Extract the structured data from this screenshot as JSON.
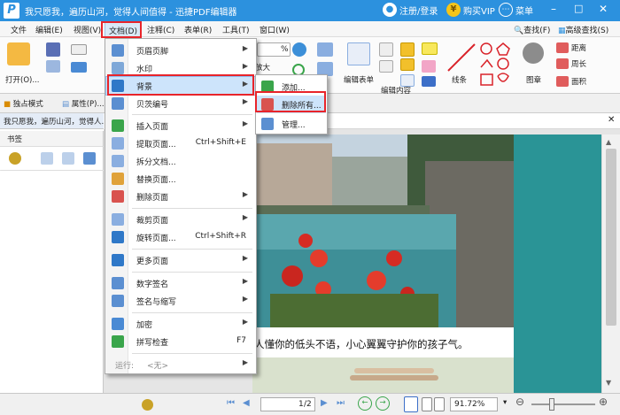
{
  "app": {
    "title": "我只愿我，遍历山河，觉得人间值得  -  迅捷PDF编辑器",
    "logo_letter": "P",
    "login": "注册/登录",
    "vip": "购买VIP",
    "menu": "菜单",
    "yen": "¥"
  },
  "menubar": {
    "items": [
      "文件",
      "编辑(E)",
      "视图(V)",
      "文档(D)",
      "注释(C)",
      "表单(R)",
      "工具(T)",
      "窗口(W)"
    ],
    "right_items": [
      "查找(F)",
      "高级查找(S)"
    ]
  },
  "ribbon": {
    "open_label": "打开(O)...",
    "zoom_value": "%",
    "enlarge": "放大",
    "edit_form": "编辑表单",
    "edit_content": "编辑内容",
    "line": "线条",
    "stamp": "图章",
    "distance": "距离",
    "perimeter": "周长",
    "area": "面积"
  },
  "toolbar2": {
    "exclusive_mode": "独占模式",
    "properties": "属性(P)...",
    "doc_tab_title": "我只愿我，遍历山河，觉得人..."
  },
  "sidebar": {
    "title": "书签"
  },
  "document": {
    "caption": "一个人懂你的低头不语，小心翼翼守护你的孩子气。"
  },
  "statusbar": {
    "page_current": "1",
    "page_total": "/2",
    "zoom": "91.72%"
  },
  "dropdown": {
    "items": [
      {
        "label": "页眉页脚",
        "shortcut": "",
        "submenu": true,
        "icon_color": "#5b8fd1"
      },
      {
        "label": "水印",
        "shortcut": "",
        "submenu": true,
        "icon_color": "#7fa8d8"
      },
      {
        "label": "背景",
        "shortcut": "",
        "submenu": true,
        "icon_color": "#2f78c8"
      },
      {
        "label": "贝茨编号",
        "shortcut": "",
        "submenu": true,
        "icon_color": "#5b8fd1"
      },
      {
        "label": "插入页面",
        "shortcut": "",
        "submenu": true,
        "icon_color": "#3aa54b"
      },
      {
        "label": "提取页面...",
        "shortcut": "Ctrl+Shift+E",
        "submenu": false,
        "icon_color": "#8aaee0"
      },
      {
        "label": "拆分文档...",
        "shortcut": "",
        "submenu": false,
        "icon_color": "#8aaee0"
      },
      {
        "label": "替换页面...",
        "shortcut": "",
        "submenu": false,
        "icon_color": "#e0a23a"
      },
      {
        "label": "删除页面",
        "shortcut": "",
        "submenu": true,
        "icon_color": "#d9534f"
      },
      {
        "label": "裁剪页面",
        "shortcut": "",
        "submenu": true,
        "icon_color": "#8aaee0"
      },
      {
        "label": "旋转页面...",
        "shortcut": "Ctrl+Shift+R",
        "submenu": false,
        "icon_color": "#2f78c8"
      },
      {
        "label": "更多页面",
        "shortcut": "",
        "submenu": true,
        "icon_color": "#2f78c8"
      },
      {
        "label": "数字签名",
        "shortcut": "",
        "submenu": true,
        "icon_color": "#5b8fd1"
      },
      {
        "label": "签名与缩写",
        "shortcut": "",
        "submenu": true,
        "icon_color": "#5b8fd1"
      },
      {
        "label": "加密",
        "shortcut": "",
        "submenu": true,
        "icon_color": "#4a8ad4"
      },
      {
        "label": "拼写检查",
        "shortcut": "F7",
        "submenu": false,
        "icon_color": "#3aa54b"
      }
    ],
    "run_label": "运行:",
    "run_value": "<无>"
  },
  "submenu": {
    "items": [
      "添加...",
      "删除所有...",
      "管理..."
    ]
  },
  "colors": {
    "titlebar": "#2c91de",
    "highlight_red": "#e8242a",
    "teal": "#2a9496"
  }
}
